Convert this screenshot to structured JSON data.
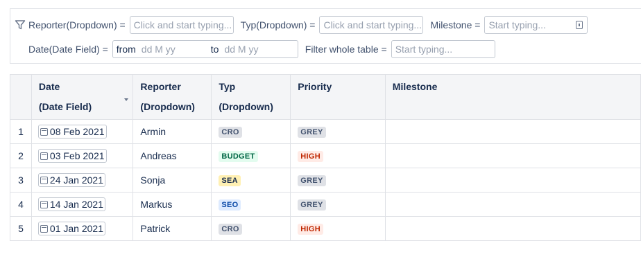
{
  "filters": {
    "reporter": {
      "label": "Reporter(Dropdown) =",
      "placeholder": "Click and start typing..."
    },
    "typ": {
      "label": "Typ(Dropdown) =",
      "placeholder": "Click and start typing..."
    },
    "milestone": {
      "label": "Milestone =",
      "placeholder": "Start typing..."
    },
    "date": {
      "label": "Date(Date Field) =",
      "from_label": "from",
      "from_placeholder": "dd M yy",
      "to_label": "to",
      "to_placeholder": "dd M yy"
    },
    "whole_table": {
      "label": "Filter whole table =",
      "placeholder": "Start typing..."
    }
  },
  "table": {
    "columns": [
      {
        "line1": "",
        "line2": ""
      },
      {
        "line1": "Date",
        "line2": "(Date Field)"
      },
      {
        "line1": "Reporter",
        "line2": "(Dropdown)"
      },
      {
        "line1": "Typ",
        "line2": "(Dropdown)"
      },
      {
        "line1": "Priority",
        "line2": ""
      },
      {
        "line1": "Milestone",
        "line2": ""
      }
    ],
    "rows": [
      {
        "num": "1",
        "date": "08 Feb 2021",
        "reporter": "Armin",
        "typ": "CRO",
        "typ_color": "#dfe1e6",
        "priority": "GREY",
        "priority_color": "#dfe1e6",
        "milestone": ""
      },
      {
        "num": "2",
        "date": "03 Feb 2021",
        "reporter": "Andreas",
        "typ": "BUDGET",
        "typ_color": "#e3fcef",
        "priority": "HIGH",
        "priority_color": "#ffebe6",
        "milestone": ""
      },
      {
        "num": "3",
        "date": "24 Jan 2021",
        "reporter": "Sonja",
        "typ": "SEA",
        "typ_color": "#fff0b3",
        "priority": "GREY",
        "priority_color": "#dfe1e6",
        "milestone": ""
      },
      {
        "num": "4",
        "date": "14 Jan 2021",
        "reporter": "Markus",
        "typ": "SEO",
        "typ_color": "#deebff",
        "priority": "GREY",
        "priority_color": "#dfe1e6",
        "milestone": ""
      },
      {
        "num": "5",
        "date": "01 Jan 2021",
        "reporter": "Patrick",
        "typ": "CRO",
        "typ_color": "#dfe1e6",
        "priority": "HIGH",
        "priority_color": "#ffebe6",
        "milestone": ""
      }
    ]
  },
  "icons": {
    "filter": "funnel-icon",
    "calendar": "calendar-icon",
    "milestone": "milestone-picker-icon",
    "sort": "sort-descending-icon"
  }
}
